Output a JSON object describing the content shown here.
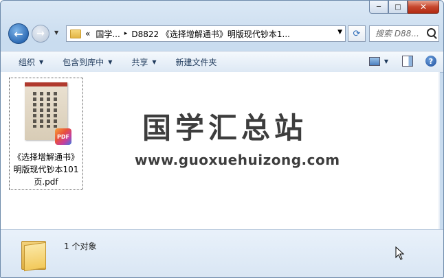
{
  "window": {
    "minimize": "─",
    "maximize": "□",
    "close": "✕"
  },
  "address": {
    "prefix": "«",
    "crumb1": "国学...",
    "crumb2": "D8822 《选择增解通书》明版现代钞本1...",
    "separator": "▸"
  },
  "search": {
    "placeholder": "搜索 D88..."
  },
  "toolbar": {
    "organize": "组织",
    "include_library": "包含到库中",
    "share": "共享",
    "new_folder": "新建文件夹"
  },
  "file": {
    "name": "《选择增解通书》明版现代钞本101页.pdf",
    "badge": "PDF"
  },
  "watermark": {
    "title": "国学汇总站",
    "url": "www.guoxuehuizong.com"
  },
  "status": {
    "count_text": "1 个对象"
  }
}
